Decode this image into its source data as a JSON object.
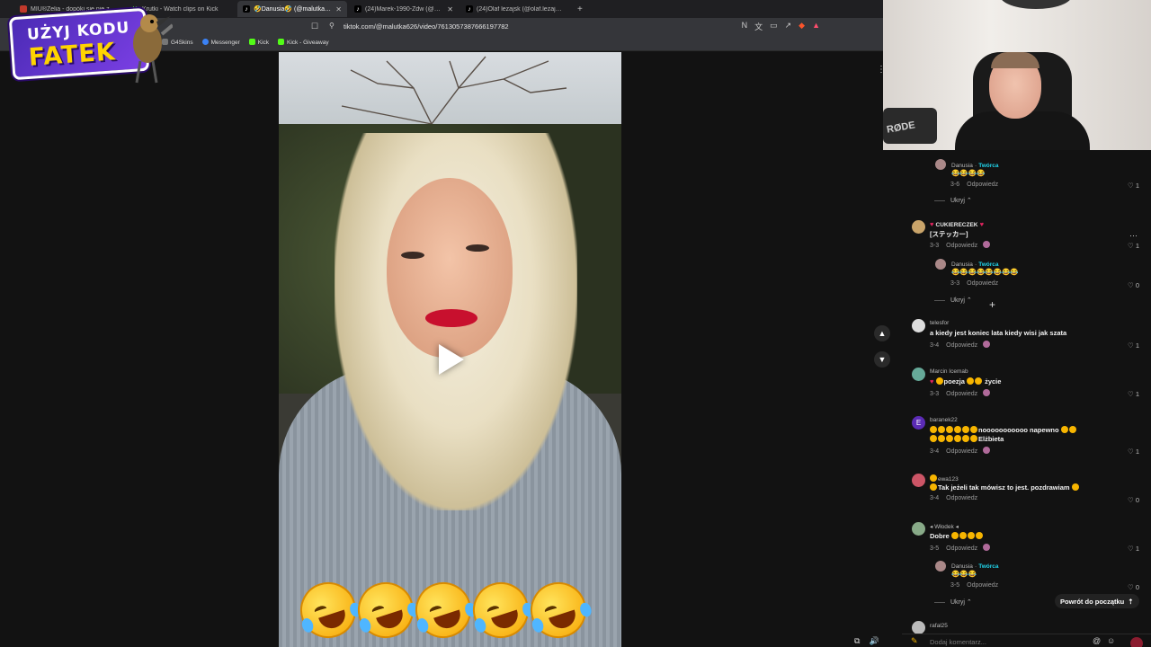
{
  "browser": {
    "tabs": [
      {
        "title": "MIÚ®Żelia - dopóki się nie znudzi...",
        "icon": "red"
      },
      {
        "title": "Krutki - Watch clips on Kick",
        "icon": "kick"
      },
      {
        "title": "🤣Danusia🤣 (@malutka626) |",
        "icon": "emoji",
        "active": true
      },
      {
        "title": "(24)Marek-1990-Zdw (@marek.slow...",
        "icon": "tiktok"
      },
      {
        "title": "(24)Olaf lezajsk (@olaf.lezajsk) | TikT...",
        "icon": "tiktok"
      }
    ],
    "url": "tiktok.com/@malutka626/video/7613057387666197782",
    "bookmarks": [
      "G4Skins",
      "Messenger",
      "Kick",
      "Kick - Giveaway"
    ]
  },
  "overlay": {
    "line1": "UŻYJ KODU",
    "line2": "FATEK"
  },
  "video": {
    "caption_emojis": "🤣🤣🤣🤣🤣"
  },
  "comments": {
    "creator_label": "Twórca",
    "reply_label": "Odpowiedz",
    "hide_label": "Ukryj",
    "items": [
      {
        "user": "Danusia",
        "creator": true,
        "text": "😂😂😂😂",
        "date": "3-6",
        "likes": "1"
      },
      {
        "user": "CUKIERECZEK",
        "text": "[ステッカー]",
        "date": "3-3",
        "likes": "1"
      },
      {
        "user": "Danusia",
        "creator": true,
        "text": "😂😂😂😂😂😂😂😂",
        "date": "3-3",
        "likes": "0"
      },
      {
        "user": "telesfor",
        "text": "a kiedy jest koniec lata kiedy wisi jak szata",
        "date": "3-4",
        "likes": "1"
      },
      {
        "user": "Marcin Icemab",
        "text": "poezja",
        "text2": "życie",
        "date": "3-3",
        "likes": "1"
      },
      {
        "user": "baranek22",
        "text": "nooooooooooo napewno",
        "text2": "Elżbieta",
        "date": "3-4",
        "likes": "1"
      },
      {
        "user": "ewa123",
        "text": "Tak jeżeli tak mówisz to jest. pozdrawiam",
        "date": "3-4",
        "likes": "0"
      },
      {
        "user": "Włodek",
        "text": "Dobre",
        "date": "3-5",
        "likes": "1"
      },
      {
        "user": "Danusia",
        "creator": true,
        "text": "😂😂😂",
        "date": "3-5",
        "likes": "0"
      },
      {
        "user": "rafal25"
      }
    ],
    "back_to_top": "Powrót do początku",
    "composer_placeholder": "Dodaj komentarz..."
  }
}
